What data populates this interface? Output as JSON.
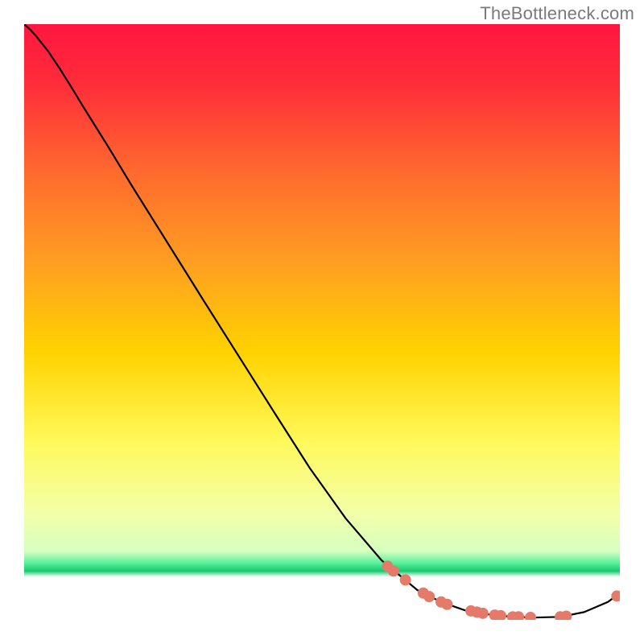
{
  "watermark": "TheBottleneck.com",
  "chart_data": {
    "type": "line",
    "title": "",
    "xlabel": "",
    "ylabel": "",
    "xlim": [
      0,
      100
    ],
    "ylim": [
      0,
      100
    ],
    "grid": false,
    "background_gradient": {
      "top": "#ff1a44",
      "mid_upper": "#ff8a2a",
      "mid": "#ffd400",
      "mid_lower": "#f7ff6e",
      "green": "#2fe07a",
      "bottom_white": "#ffffff"
    },
    "series": [
      {
        "name": "curve",
        "type": "line",
        "color": "#000000",
        "x": [
          0,
          1,
          2,
          4,
          6,
          8,
          10,
          14,
          18,
          24,
          30,
          36,
          42,
          48,
          54,
          60,
          66,
          70,
          74,
          78,
          82,
          86,
          90,
          94,
          98,
          100
        ],
        "y": [
          100,
          99.1,
          98.0,
          95.5,
          92.5,
          89.3,
          86.0,
          79.6,
          73.0,
          63.4,
          53.8,
          44.3,
          34.8,
          25.4,
          17.0,
          10.0,
          5.0,
          3.0,
          1.6,
          0.9,
          0.5,
          0.4,
          0.5,
          1.3,
          3.0,
          4.5
        ]
      },
      {
        "name": "markers",
        "type": "scatter",
        "color": "#e47a6a",
        "radius": 7,
        "x": [
          61,
          62,
          64,
          67,
          68,
          70,
          71,
          75,
          76,
          77,
          79,
          80,
          82,
          83,
          85,
          90,
          91,
          99.5
        ],
        "y": [
          9.0,
          8.2,
          6.7,
          4.5,
          3.9,
          3.0,
          2.6,
          1.5,
          1.3,
          1.1,
          0.8,
          0.7,
          0.5,
          0.5,
          0.4,
          0.5,
          0.6,
          4.0
        ]
      }
    ]
  }
}
